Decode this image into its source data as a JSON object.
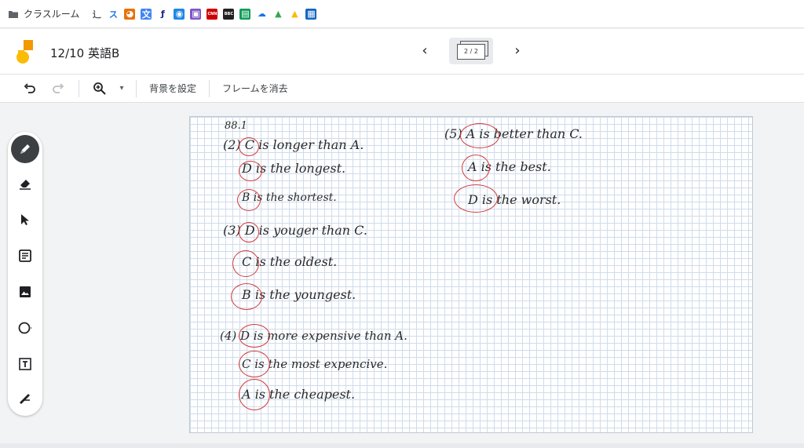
{
  "bookmarks": {
    "folder_label": "クラスルーム",
    "icons": [
      {
        "name": "calligraphy-icon",
        "glyph": "⻌",
        "color": "#555555",
        "bg": "#ffffff"
      },
      {
        "name": "su-icon",
        "glyph": "ス",
        "color": "#1a73e8",
        "bg": "#ffffff"
      },
      {
        "name": "fox-icon",
        "glyph": "◕",
        "color": "#ffffff",
        "bg": "#e8710a"
      },
      {
        "name": "translate-icon",
        "glyph": "文",
        "color": "#ffffff",
        "bg": "#4285f4"
      },
      {
        "name": "pen-icon",
        "glyph": "ƒ",
        "color": "#1a237e",
        "bg": "#ffffff"
      },
      {
        "name": "compass-icon",
        "glyph": "◉",
        "color": "#ffffff",
        "bg": "#1e88e5"
      },
      {
        "name": "stack-icon",
        "glyph": "▣",
        "color": "#ffffff",
        "bg": "#7e57c2"
      },
      {
        "name": "cnn-icon",
        "glyph": "CNN",
        "color": "#ffffff",
        "bg": "#cc0000"
      },
      {
        "name": "bbc-icon",
        "glyph": "BBC",
        "color": "#ffffff",
        "bg": "#222222"
      },
      {
        "name": "classroom-icon",
        "glyph": "▤",
        "color": "#ffffff",
        "bg": "#0f9d58"
      },
      {
        "name": "cloud-icon",
        "glyph": "☁",
        "color": "#1a73e8",
        "bg": "#ffffff"
      },
      {
        "name": "drive-icon",
        "glyph": "▲",
        "color": "#34a853",
        "bg": "#ffffff"
      },
      {
        "name": "drive-icon-2",
        "glyph": "▲",
        "color": "#fbbc04",
        "bg": "#ffffff"
      },
      {
        "name": "newspaper-icon",
        "glyph": "▦",
        "color": "#ffffff",
        "bg": "#1565c0"
      }
    ]
  },
  "header": {
    "title": "12/10 英語B",
    "frame_counter": "2 / 2"
  },
  "toolbar": {
    "set_background": "背景を設定",
    "clear_frame": "フレームを消去"
  },
  "palette": {
    "tools": [
      "pen-tool",
      "eraser-tool",
      "select-tool",
      "sticky-note-tool",
      "image-tool",
      "shape-tool",
      "text-box-tool",
      "laser-tool"
    ]
  },
  "canvas": {
    "lines": [
      {
        "id": "l0",
        "text": "88.1"
      },
      {
        "id": "l1",
        "text": "(2) C is longer than A."
      },
      {
        "id": "l2",
        "text": "D is the longest."
      },
      {
        "id": "l3",
        "text": "B is the shortest."
      },
      {
        "id": "l4",
        "text": "(3) D is youger than C."
      },
      {
        "id": "l5",
        "text": "C is the oldest."
      },
      {
        "id": "l6",
        "text": "B is the youngest."
      },
      {
        "id": "l7",
        "text": "(4) D is more expensive than A."
      },
      {
        "id": "l8",
        "text": "C is the most expencive."
      },
      {
        "id": "l9",
        "text": "A is the cheapest."
      },
      {
        "id": "r1",
        "text": "(5) A is better than C."
      },
      {
        "id": "r2",
        "text": "A is the best."
      },
      {
        "id": "r3",
        "text": "D is the worst."
      }
    ]
  }
}
